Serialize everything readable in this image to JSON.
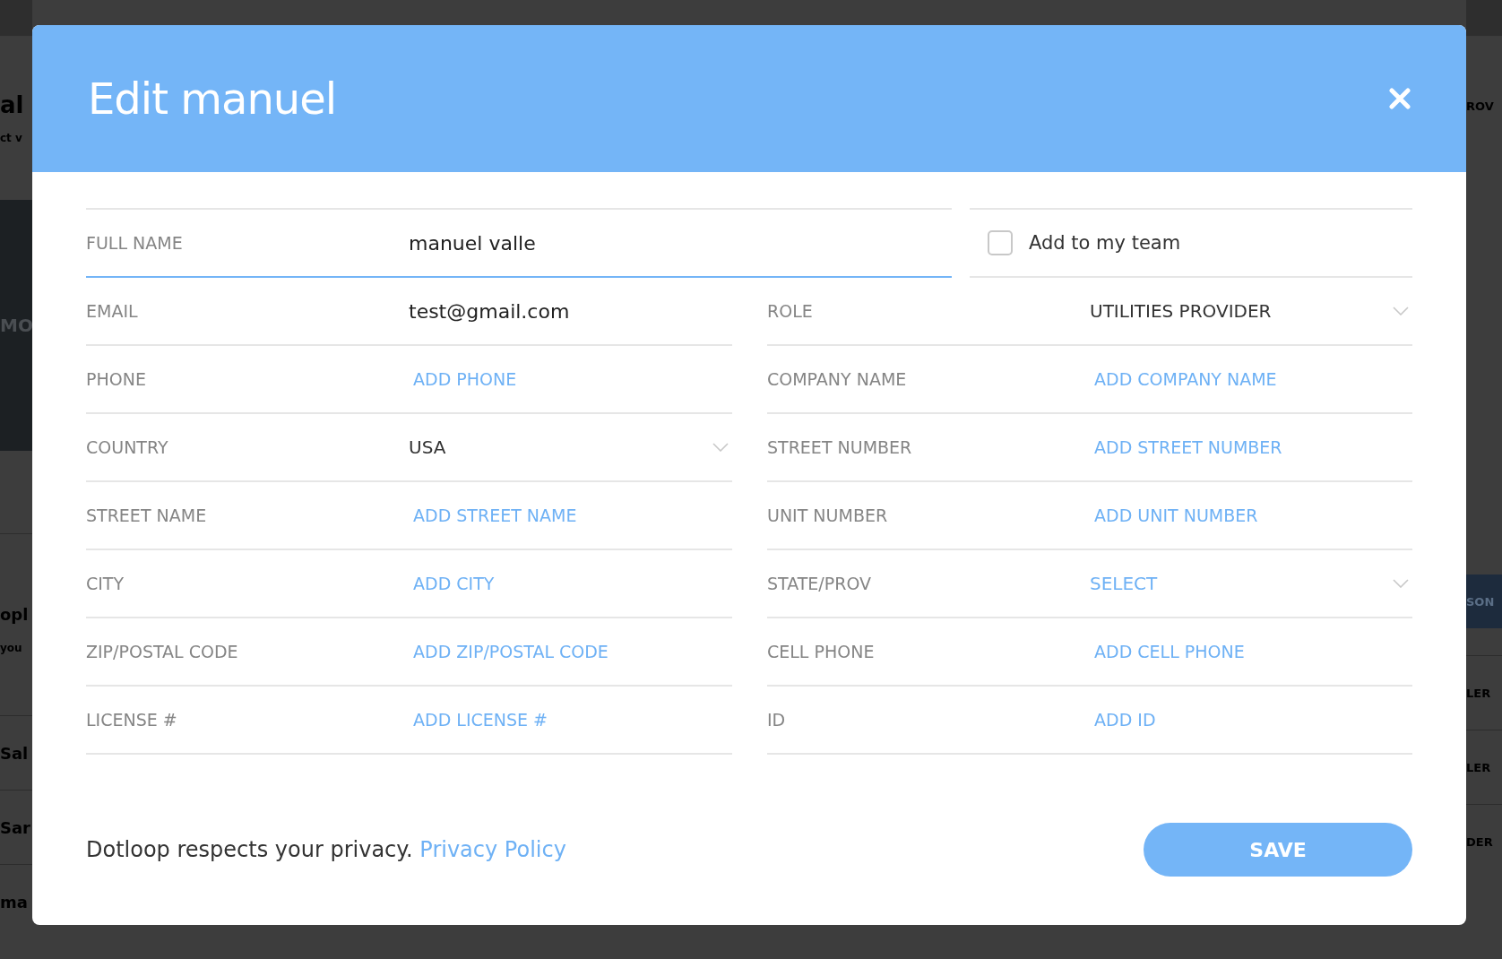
{
  "background": {
    "left": {
      "heading": "al",
      "subtext": "ct v",
      "banner_text": "MO",
      "heading_2": "opl",
      "subtext_2": "you",
      "rows": [
        "Sal",
        "Sar",
        "ma"
      ]
    },
    "right": {
      "header_action": "ROV",
      "badge": "SON",
      "rows": [
        "LER",
        "LER",
        "DER"
      ]
    }
  },
  "dialog": {
    "title": "Edit manuel",
    "full_name": {
      "label": "FULL NAME",
      "value": "manuel valle"
    },
    "team_checkbox": {
      "label": "Add to my team",
      "checked": false
    },
    "left_fields": [
      {
        "label": "EMAIL",
        "kind": "text",
        "value": "test@gmail.com"
      },
      {
        "label": "PHONE",
        "kind": "text",
        "placeholder": "ADD PHONE"
      },
      {
        "label": "COUNTRY",
        "kind": "select",
        "value": "USA"
      },
      {
        "label": "STREET NAME",
        "kind": "text",
        "placeholder": "ADD STREET NAME"
      },
      {
        "label": "CITY",
        "kind": "text",
        "placeholder": "ADD CITY"
      },
      {
        "label": "ZIP/POSTAL CODE",
        "kind": "text",
        "placeholder": "ADD ZIP/POSTAL CODE"
      },
      {
        "label": "LICENSE #",
        "kind": "text",
        "placeholder": "ADD LICENSE #"
      }
    ],
    "right_fields": [
      {
        "label": "ROLE",
        "kind": "select",
        "value": "UTILITIES PROVIDER"
      },
      {
        "label": "COMPANY NAME",
        "kind": "text",
        "placeholder": "ADD COMPANY NAME"
      },
      {
        "label": "STREET NUMBER",
        "kind": "text",
        "placeholder": "ADD STREET NUMBER"
      },
      {
        "label": "UNIT NUMBER",
        "kind": "text",
        "placeholder": "ADD UNIT NUMBER"
      },
      {
        "label": "STATE/PROV",
        "kind": "select",
        "placeholder": "SELECT"
      },
      {
        "label": "CELL PHONE",
        "kind": "text",
        "placeholder": "ADD CELL PHONE"
      },
      {
        "label": "ID",
        "kind": "text",
        "placeholder": "ADD ID"
      }
    ],
    "privacy_text": "Dotloop respects your privacy.",
    "privacy_link": "Privacy Policy",
    "save_button": "SAVE"
  }
}
